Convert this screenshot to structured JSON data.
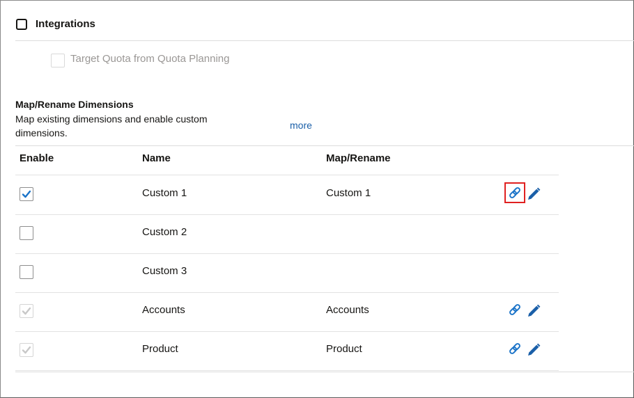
{
  "integrations": {
    "section_label": "Integrations",
    "section_checked": false,
    "option_label": "Target Quota from Quota Planning",
    "option_checked": false
  },
  "map_rename": {
    "title": "Map/Rename Dimensions",
    "description": "Map existing dimensions and enable custom dimensions.",
    "more_label": "more"
  },
  "table": {
    "headers": {
      "enable": "Enable",
      "name": "Name",
      "map": "Map/Rename"
    },
    "rows": [
      {
        "enabled": true,
        "disabled": false,
        "name": "Custom 1",
        "map": "Custom 1",
        "actions": true
      },
      {
        "enabled": false,
        "disabled": false,
        "name": "Custom 2",
        "map": "",
        "actions": false
      },
      {
        "enabled": false,
        "disabled": false,
        "name": "Custom 3",
        "map": "",
        "actions": false
      },
      {
        "enabled": true,
        "disabled": true,
        "name": "Accounts",
        "map": "Accounts",
        "actions": true
      },
      {
        "enabled": true,
        "disabled": true,
        "name": "Product",
        "map": "Product",
        "actions": true
      }
    ]
  },
  "colors": {
    "accent_blue": "#1a73c8",
    "check_disabled": "#c8c8c8",
    "highlight_red": "#e02020"
  },
  "icons": {
    "map": "link-icon",
    "rename": "pencil-icon",
    "check": "checkmark-icon"
  }
}
